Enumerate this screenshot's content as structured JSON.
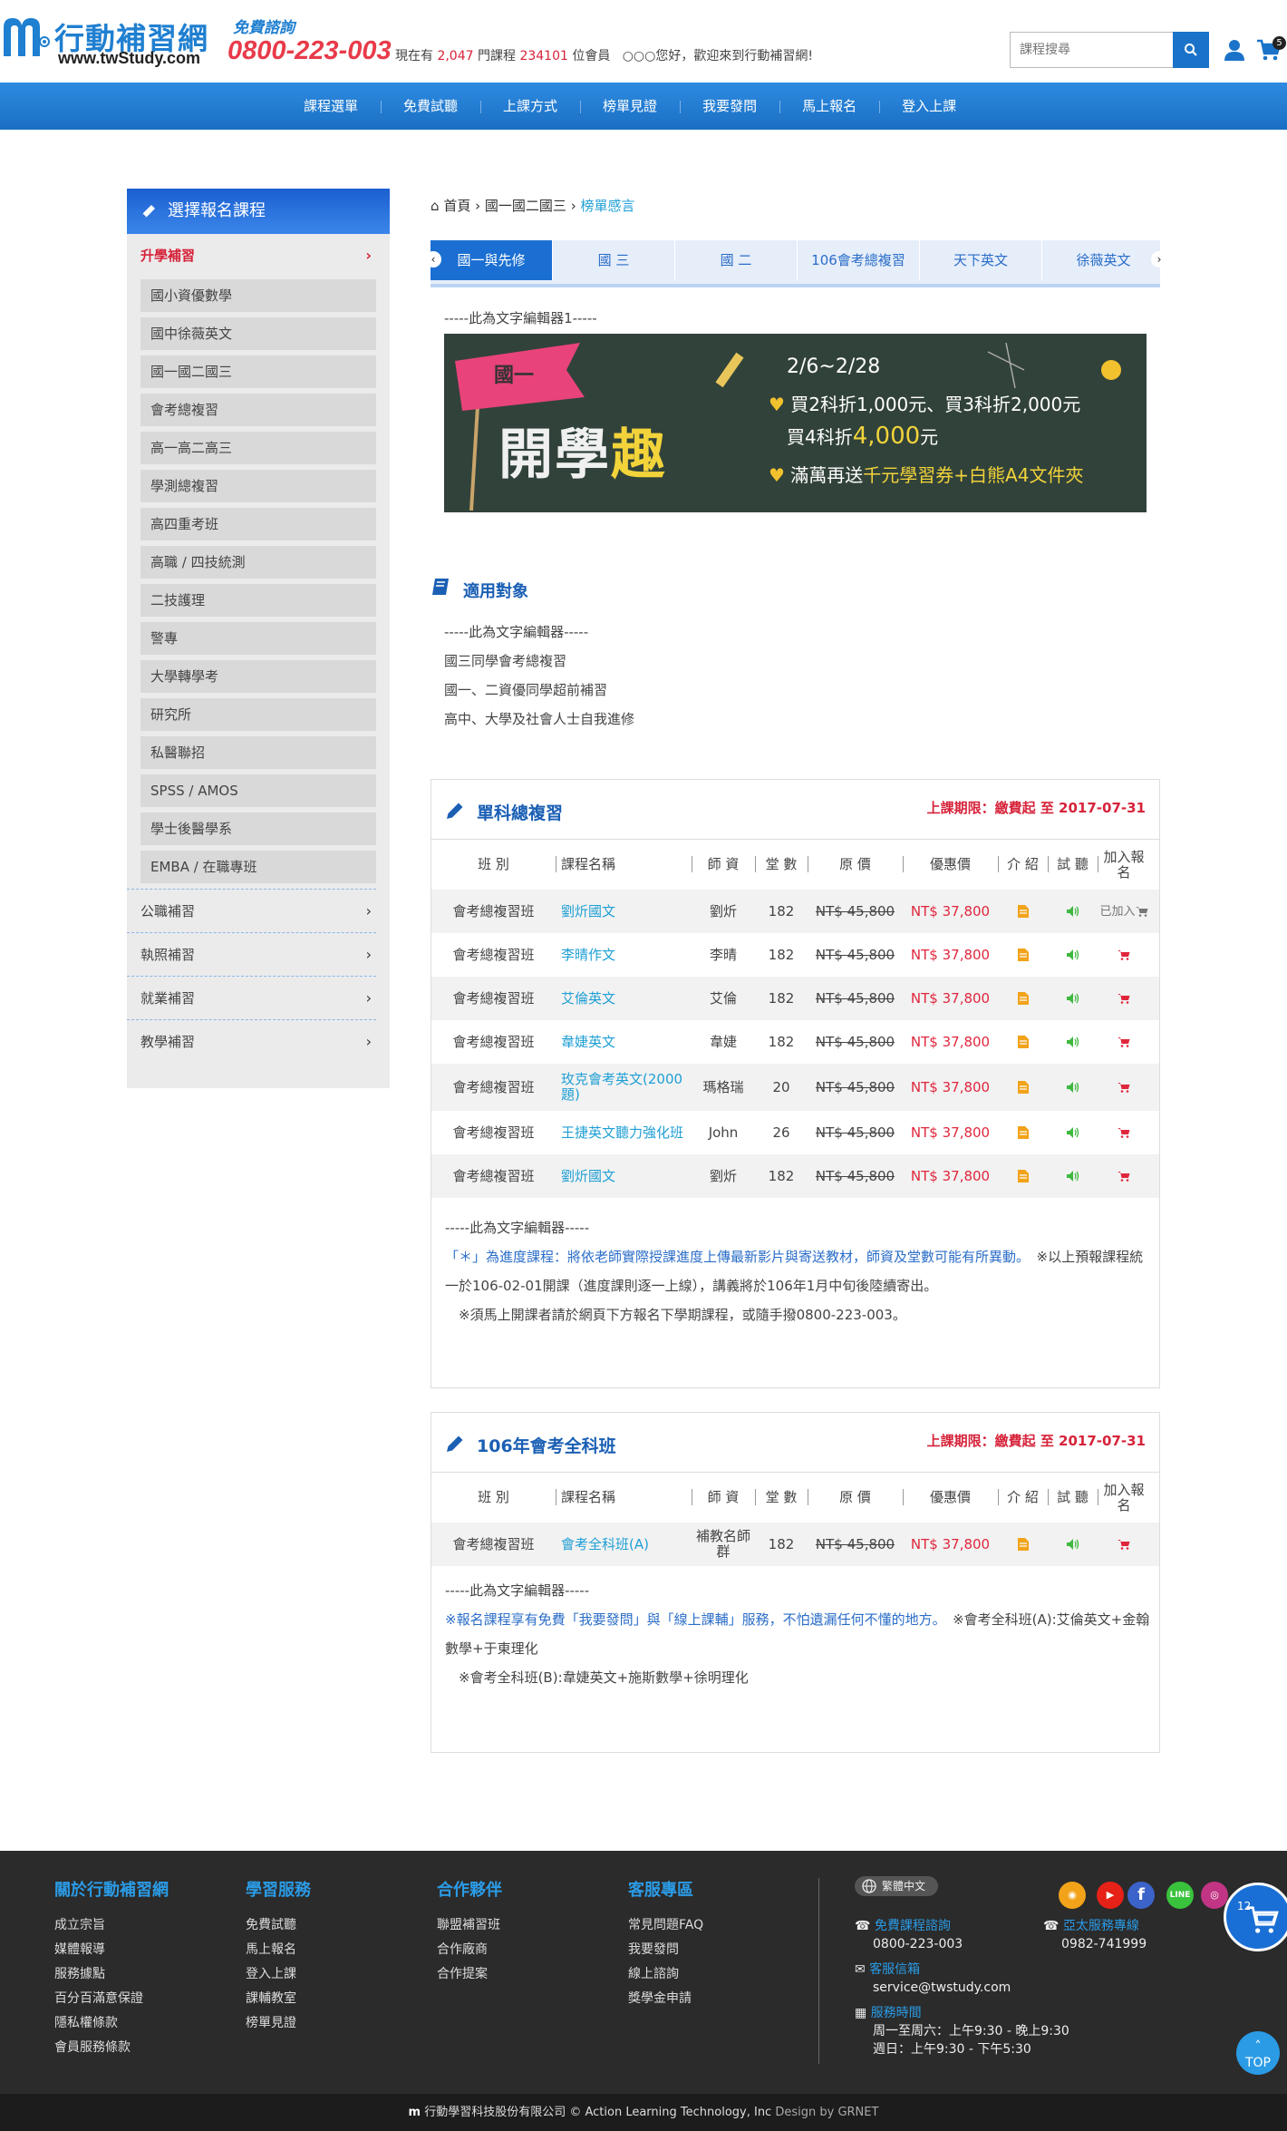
{
  "header": {
    "brand_name": "行動補習網",
    "brand_url": "www.twStudy.com",
    "hotline_label": "免費諮詢",
    "hotline_number": "0800-223-003",
    "stats_prefix": "現在有",
    "courses_count": "2,047",
    "courses_unit": "門課程",
    "members_count": "234101",
    "members_unit": "位會員",
    "greeting": "○○○您好，歡迎來到行動補習網!",
    "search_placeholder": "課程搜尋",
    "cart_count": "5"
  },
  "nav": [
    "課程選單",
    "免費試聽",
    "上課方式",
    "榜單見證",
    "我要發問",
    "馬上報名",
    "登入上課"
  ],
  "sidebar": {
    "title": "選擇報名課程",
    "active_category": "升學補習",
    "sub_items": [
      "國小資優數學",
      "國中徐薇英文",
      "國一國二國三",
      "會考總複習",
      "高一高二高三",
      "學測總複習",
      "高四重考班",
      "高職 / 四技統測",
      "二技護理",
      "警專",
      "大學轉學考",
      "研究所",
      "私醫聯招",
      "SPSS / AMOS",
      "學士後醫學系",
      "EMBA / 在職專班"
    ],
    "categories": [
      "公職補習",
      "執照補習",
      "就業補習",
      "教學補習"
    ]
  },
  "breadcrumb": {
    "home": "首頁",
    "level1": "國一國二國三",
    "current": "榜單感言"
  },
  "tabs": [
    "國一與先修",
    "國 三",
    "國 二",
    "106會考總複習",
    "天下英文",
    "徐薇英文"
  ],
  "editor1": "-----此為文字編輯器1-----",
  "banner": {
    "flag": "國一",
    "headline_a": "開學",
    "headline_b": "趣",
    "date": "2/6~2/28",
    "line1": "買2科折1,000元、買3科折2,000元",
    "line2_a": "買4科折",
    "line2_b": "4,000",
    "line2_c": "元",
    "line3_a": "滿萬再送",
    "line3_b": "千元學習券+白熊A4文件夾"
  },
  "audience": {
    "title": "適用對象",
    "lines": [
      "-----此為文字編輯器-----",
      "國三同學會考總複習",
      "國一、二資優同學超前補習",
      "高中、大學及社會人士自我進修"
    ]
  },
  "table_headers": [
    "班 別",
    "課程名稱",
    "師 資",
    "堂 數",
    "原 價",
    "優惠價",
    "介 紹",
    "試 聽",
    "加入報名"
  ],
  "course_sections": [
    {
      "title": "單科總複習",
      "deadline": "上課期限：繳費起 至 2017-07-31",
      "rows": [
        {
          "class": "會考總複習班",
          "name": "劉炘國文",
          "teacher": "劉炘",
          "lessons": "182",
          "orig": "NT$ 45,800",
          "price": "NT$ 37,800",
          "action": "已加入"
        },
        {
          "class": "會考總複習班",
          "name": "李晴作文",
          "teacher": "李晴",
          "lessons": "182",
          "orig": "NT$ 45,800",
          "price": "NT$ 37,800",
          "action": ""
        },
        {
          "class": "會考總複習班",
          "name": "艾倫英文",
          "teacher": "艾倫",
          "lessons": "182",
          "orig": "NT$ 45,800",
          "price": "NT$ 37,800",
          "action": ""
        },
        {
          "class": "會考總複習班",
          "name": "韋婕英文",
          "teacher": "韋婕",
          "lessons": "182",
          "orig": "NT$ 45,800",
          "price": "NT$ 37,800",
          "action": ""
        },
        {
          "class": "會考總複習班",
          "name": "玫克會考英文(2000題)",
          "teacher": "瑪格瑞",
          "lessons": "20",
          "orig": "NT$ 45,800",
          "price": "NT$ 37,800",
          "action": ""
        },
        {
          "class": "會考總複習班",
          "name": "王捷英文聽力強化班",
          "teacher": "John",
          "lessons": "26",
          "orig": "NT$ 45,800",
          "price": "NT$ 37,800",
          "action": ""
        },
        {
          "class": "會考總複習班",
          "name": "劉炘國文",
          "teacher": "劉炘",
          "lessons": "182",
          "orig": "NT$ 45,800",
          "price": "NT$ 37,800",
          "action": ""
        }
      ],
      "note_editor": "-----此為文字編輯器-----",
      "note_blue": "「＊」為進度課程：將依老師實際授課進度上傳最新影片與寄送教材，師資及堂數可能有所異動。",
      "note_rest": "　※以上預報課程統一於106-02-01開課（進度課則逐一上線），講義將於106年1月中旬後陸續寄出。",
      "note_last": "　※須馬上開課者請於網頁下方報名下學期課程，或隨手撥0800-223-003。"
    },
    {
      "title": "106年會考全科班",
      "deadline": "上課期限：繳費起 至 2017-07-31",
      "rows": [
        {
          "class": "會考總複習班",
          "name": "會考全科班(A)",
          "teacher": "補教名師群",
          "lessons": "182",
          "orig": "NT$ 45,800",
          "price": "NT$ 37,800",
          "action": ""
        }
      ],
      "note_editor": "-----此為文字編輯器-----",
      "note_blue": "※報名課程享有免費「我要發問」與「線上課輔」服務，不怕遺漏任何不懂的地方。",
      "note_rest": "　※會考全科班(A):艾倫英文+金翰數學+于東理化",
      "note_last": "　※會考全科班(B):韋婕英文+施斯數學+徐明理化"
    }
  ],
  "footer": {
    "cols": [
      {
        "title": "關於行動補習網",
        "items": [
          "成立宗旨",
          "媒體報導",
          "服務據點",
          "百分百滿意保證",
          "隱私權條款",
          "會員服務條款"
        ]
      },
      {
        "title": "學習服務",
        "items": [
          "免費試聽",
          "馬上報名",
          "登入上課",
          "課輔教室",
          "榜單見證"
        ]
      },
      {
        "title": "合作夥伴",
        "items": [
          "聯盟補習班",
          "合作廠商",
          "合作提案"
        ]
      },
      {
        "title": "客服專區",
        "items": [
          "常見問題FAQ",
          "我要發問",
          "線上諮詢",
          "獎學金申請"
        ]
      }
    ],
    "language": "繁體中文",
    "free_consult_label": "免費課程諮詢",
    "free_consult_number": "0800-223-003",
    "asia_label": "亞太服務專線",
    "asia_number": "0982-741999",
    "email_label": "客服信箱",
    "email": "service@twstudy.com",
    "hours_label": "服務時間",
    "hours_1": "周一至周六：上午9:30 - 晚上9:30",
    "hours_2": "週日：上午9:30 - 下午5:30",
    "social_line": "LINE",
    "float_cart_count": "12",
    "top_label": "TOP"
  },
  "copyright": {
    "text": "行動學習科技股份有限公司 © Action Learning Technology, Inc",
    "design": "Design by GRNET"
  }
}
